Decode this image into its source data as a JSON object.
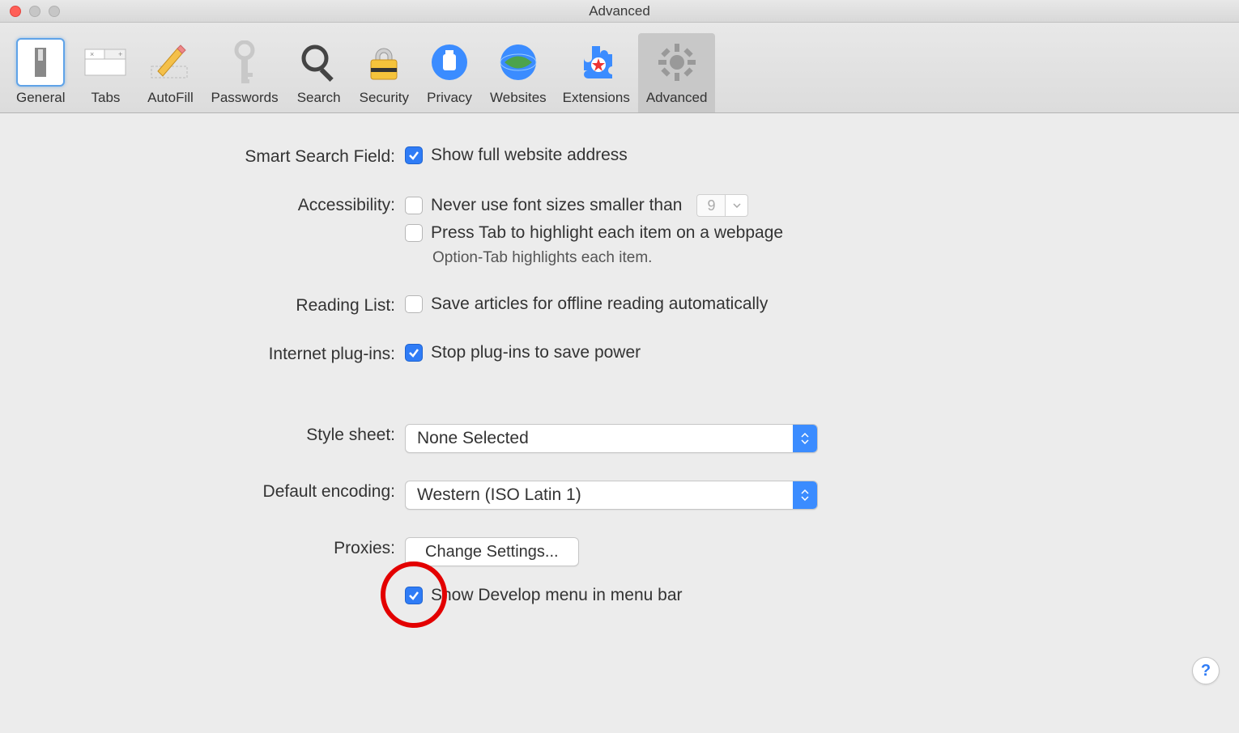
{
  "window": {
    "title": "Advanced"
  },
  "toolbar": {
    "items": [
      {
        "label": "General"
      },
      {
        "label": "Tabs"
      },
      {
        "label": "AutoFill"
      },
      {
        "label": "Passwords"
      },
      {
        "label": "Search"
      },
      {
        "label": "Security"
      },
      {
        "label": "Privacy"
      },
      {
        "label": "Websites"
      },
      {
        "label": "Extensions"
      },
      {
        "label": "Advanced"
      }
    ]
  },
  "sections": {
    "smartSearch": {
      "label": "Smart Search Field:",
      "showFullAddress": "Show full website address"
    },
    "accessibility": {
      "label": "Accessibility:",
      "neverUseFontSize": "Never use font sizes smaller than",
      "fontSizeValue": "9",
      "pressTab": "Press Tab to highlight each item on a webpage",
      "optionTabHint": "Option-Tab highlights each item."
    },
    "readingList": {
      "label": "Reading List:",
      "saveOffline": "Save articles for offline reading automatically"
    },
    "internetPlugins": {
      "label": "Internet plug-ins:",
      "stopPlugins": "Stop plug-ins to save power"
    },
    "styleSheet": {
      "label": "Style sheet:",
      "value": "None Selected"
    },
    "defaultEncoding": {
      "label": "Default encoding:",
      "value": "Western (ISO Latin 1)"
    },
    "proxies": {
      "label": "Proxies:",
      "button": "Change Settings..."
    },
    "developMenu": {
      "label": "Show Develop menu in menu bar"
    }
  },
  "help": {
    "label": "?"
  }
}
